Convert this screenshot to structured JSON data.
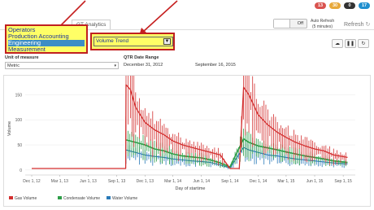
{
  "tabs": {
    "first_label": "",
    "second_label": "",
    "active_label": "GT Analytics"
  },
  "badges": [
    {
      "label": "13",
      "color": "#d9534f"
    },
    {
      "label": "30",
      "color": "#e8a93a"
    },
    {
      "label": "0",
      "color": "#333333"
    },
    {
      "label": "17",
      "color": "#1f8fcf"
    }
  ],
  "refresh": {
    "toggle_state": "Off",
    "auto_label": "Auto Refresh",
    "auto_sub": "(5 minutes)",
    "refresh_label": "Refresh"
  },
  "dropdown": {
    "options": [
      "Operators",
      "Production Accounting",
      "Engineering",
      "Measurement"
    ],
    "selected": "Engineering"
  },
  "report_select": {
    "value": "Volume Trend"
  },
  "unit": {
    "label": "Unit of measure",
    "value": "Metric"
  },
  "date_range": {
    "label": "QTR Date Range",
    "start": "December 31, 2012",
    "end": "September 16, 2015"
  },
  "chart_controls": [
    "cloud-download",
    "pause",
    "refresh"
  ],
  "colors": {
    "gas": "#d32f2f",
    "condensate": "#2e9e48",
    "water": "#2a7ab8"
  },
  "chart_data": {
    "type": "line",
    "title": "",
    "xlabel": "Day of startime",
    "ylabel": "Volume",
    "ylim": [
      -10,
      175
    ],
    "yticks": [
      "0",
      "50",
      "100",
      "150"
    ],
    "xticks": [
      "Dec 1, 12",
      "Mar 1, 13",
      "Jun 1, 13",
      "Sep 1, 13",
      "Dec 1, 13",
      "Mar 1, 14",
      "Jun 1, 14",
      "Sep 1, 14",
      "Dec 1, 14",
      "Mar 1, 15",
      "Jun 1, 15",
      "Sep 1, 15"
    ],
    "legend_placement": "bottom-left",
    "series": [
      {
        "name": "Gas Volume",
        "points": [
          [
            "2012-12-01",
            3
          ],
          [
            "2013-09-30",
            3
          ],
          [
            "2013-10-01",
            170
          ],
          [
            "2013-10-15",
            160
          ],
          [
            "2013-11-01",
            125
          ],
          [
            "2013-12-01",
            95
          ],
          [
            "2014-01-01",
            80
          ],
          [
            "2014-02-01",
            70
          ],
          [
            "2014-03-01",
            58
          ],
          [
            "2014-04-01",
            50
          ],
          [
            "2014-05-01",
            45
          ],
          [
            "2014-06-01",
            40
          ],
          [
            "2014-07-01",
            35
          ],
          [
            "2014-08-01",
            30
          ],
          [
            "2014-09-01",
            3
          ],
          [
            "2014-10-01",
            3
          ],
          [
            "2014-10-15",
            165
          ],
          [
            "2014-11-01",
            150
          ],
          [
            "2014-12-01",
            110
          ],
          [
            "2015-01-01",
            90
          ],
          [
            "2015-02-01",
            75
          ],
          [
            "2015-03-01",
            65
          ],
          [
            "2015-04-01",
            55
          ],
          [
            "2015-05-01",
            48
          ],
          [
            "2015-06-01",
            42
          ],
          [
            "2015-07-01",
            38
          ],
          [
            "2015-08-01",
            30
          ],
          [
            "2015-09-15",
            25
          ]
        ]
      },
      {
        "name": "Condensate Volume",
        "points": [
          [
            "2013-10-01",
            60
          ],
          [
            "2013-11-01",
            55
          ],
          [
            "2013-12-01",
            50
          ],
          [
            "2014-01-01",
            42
          ],
          [
            "2014-02-01",
            38
          ],
          [
            "2014-03-01",
            32
          ],
          [
            "2014-04-01",
            28
          ],
          [
            "2014-05-01",
            26
          ],
          [
            "2014-06-01",
            24
          ],
          [
            "2014-07-01",
            20
          ],
          [
            "2014-08-01",
            14
          ],
          [
            "2014-09-01",
            6
          ],
          [
            "2014-10-15",
            62
          ],
          [
            "2014-11-01",
            55
          ],
          [
            "2014-12-01",
            48
          ],
          [
            "2015-01-01",
            44
          ],
          [
            "2015-02-01",
            40
          ],
          [
            "2015-03-01",
            36
          ],
          [
            "2015-04-01",
            32
          ],
          [
            "2015-05-01",
            28
          ],
          [
            "2015-06-01",
            25
          ],
          [
            "2015-07-01",
            22
          ],
          [
            "2015-08-01",
            18
          ],
          [
            "2015-09-15",
            15
          ]
        ]
      },
      {
        "name": "Water Volume",
        "points": [
          [
            "2013-10-01",
            40
          ],
          [
            "2013-11-01",
            35
          ],
          [
            "2013-12-01",
            30
          ],
          [
            "2014-01-01",
            27
          ],
          [
            "2014-02-01",
            25
          ],
          [
            "2014-03-01",
            22
          ],
          [
            "2014-04-01",
            20
          ],
          [
            "2014-05-01",
            18
          ],
          [
            "2014-06-01",
            17
          ],
          [
            "2014-07-01",
            15
          ],
          [
            "2014-08-01",
            10
          ],
          [
            "2014-09-01",
            4
          ],
          [
            "2014-10-15",
            45
          ],
          [
            "2014-11-01",
            40
          ],
          [
            "2014-12-01",
            35
          ],
          [
            "2015-01-01",
            30
          ],
          [
            "2015-02-01",
            28
          ],
          [
            "2015-03-01",
            25
          ],
          [
            "2015-04-01",
            22
          ],
          [
            "2015-05-01",
            20
          ],
          [
            "2015-06-01",
            18
          ],
          [
            "2015-07-01",
            16
          ],
          [
            "2015-08-01",
            14
          ],
          [
            "2015-09-15",
            12
          ]
        ]
      }
    ]
  }
}
